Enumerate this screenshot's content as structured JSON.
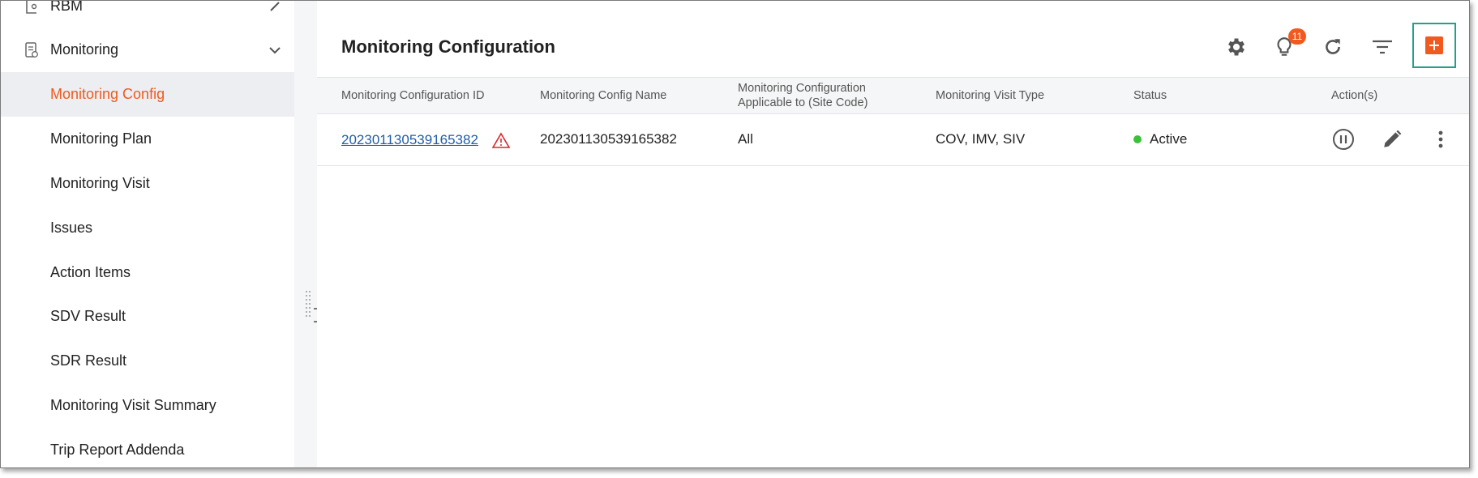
{
  "sidebar": {
    "items": [
      {
        "label": "RBM"
      },
      {
        "label": "Monitoring"
      },
      {
        "label": "Monitoring Config"
      },
      {
        "label": "Monitoring Plan"
      },
      {
        "label": "Monitoring Visit"
      },
      {
        "label": "Issues"
      },
      {
        "label": "Action Items"
      },
      {
        "label": "SDV Result"
      },
      {
        "label": "SDR Result"
      },
      {
        "label": "Monitoring Visit Summary"
      },
      {
        "label": "Trip Report Addenda"
      }
    ],
    "active_index": 2
  },
  "header": {
    "title": "Monitoring Configuration",
    "notification_count": "11"
  },
  "table": {
    "columns": [
      "Monitoring Configuration ID",
      "Monitoring Config Name",
      "Monitoring Configuration Applicable to (Site Code)",
      "Monitoring Visit Type",
      "Status",
      "Action(s)"
    ],
    "rows": [
      {
        "id": "202301130539165382",
        "name": "202301130539165382",
        "applicable_to": "All",
        "visit_type": "COV, IMV, SIV",
        "status": "Active"
      }
    ]
  },
  "colors": {
    "accent": "#f05a1e",
    "link": "#1f5da8",
    "status_active": "#3cc13b",
    "highlight_border": "#22a08a",
    "warning": "#d9262c"
  }
}
